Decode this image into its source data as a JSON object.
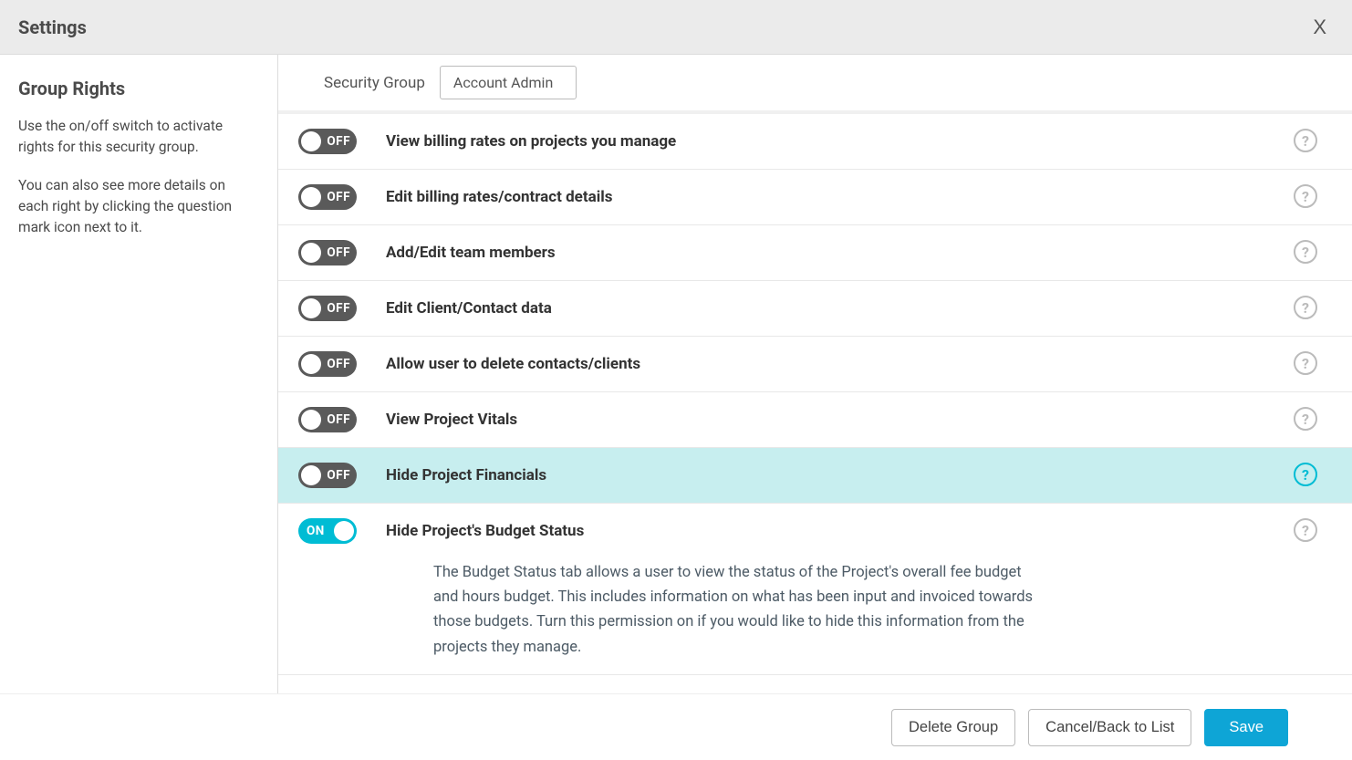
{
  "header": {
    "title": "Settings",
    "close_glyph": "X"
  },
  "sidebar": {
    "title": "Group Rights",
    "para1": "Use the on/off switch to activate rights for this security group.",
    "para2": "You can also see more details on each right by clicking the question mark icon next to it."
  },
  "filter": {
    "label": "Security Group",
    "value": "Account Admin"
  },
  "toggle_labels": {
    "on": "ON",
    "off": "OFF"
  },
  "help_glyph": "?",
  "rights": [
    {
      "on": false,
      "title": "View billing rates on projects you manage",
      "highlighted": false
    },
    {
      "on": false,
      "title": "Edit billing rates/contract details",
      "highlighted": false
    },
    {
      "on": false,
      "title": "Add/Edit team members",
      "highlighted": false
    },
    {
      "on": false,
      "title": "Edit Client/Contact data",
      "highlighted": false
    },
    {
      "on": false,
      "title": "Allow user to delete contacts/clients",
      "highlighted": false
    },
    {
      "on": false,
      "title": "View Project Vitals",
      "highlighted": false
    },
    {
      "on": false,
      "title": "Hide Project Financials",
      "highlighted": true
    },
    {
      "on": true,
      "title": "Hide Project's Budget Status",
      "highlighted": false,
      "description": "The Budget Status tab allows a user to view the status of the Project's overall fee budget and hours budget. This includes information on what has been input and invoiced towards those budgets. Turn this permission on if you would like to hide this information from the projects they manage."
    }
  ],
  "footer": {
    "delete": "Delete Group",
    "cancel": "Cancel/Back to List",
    "save": "Save"
  }
}
